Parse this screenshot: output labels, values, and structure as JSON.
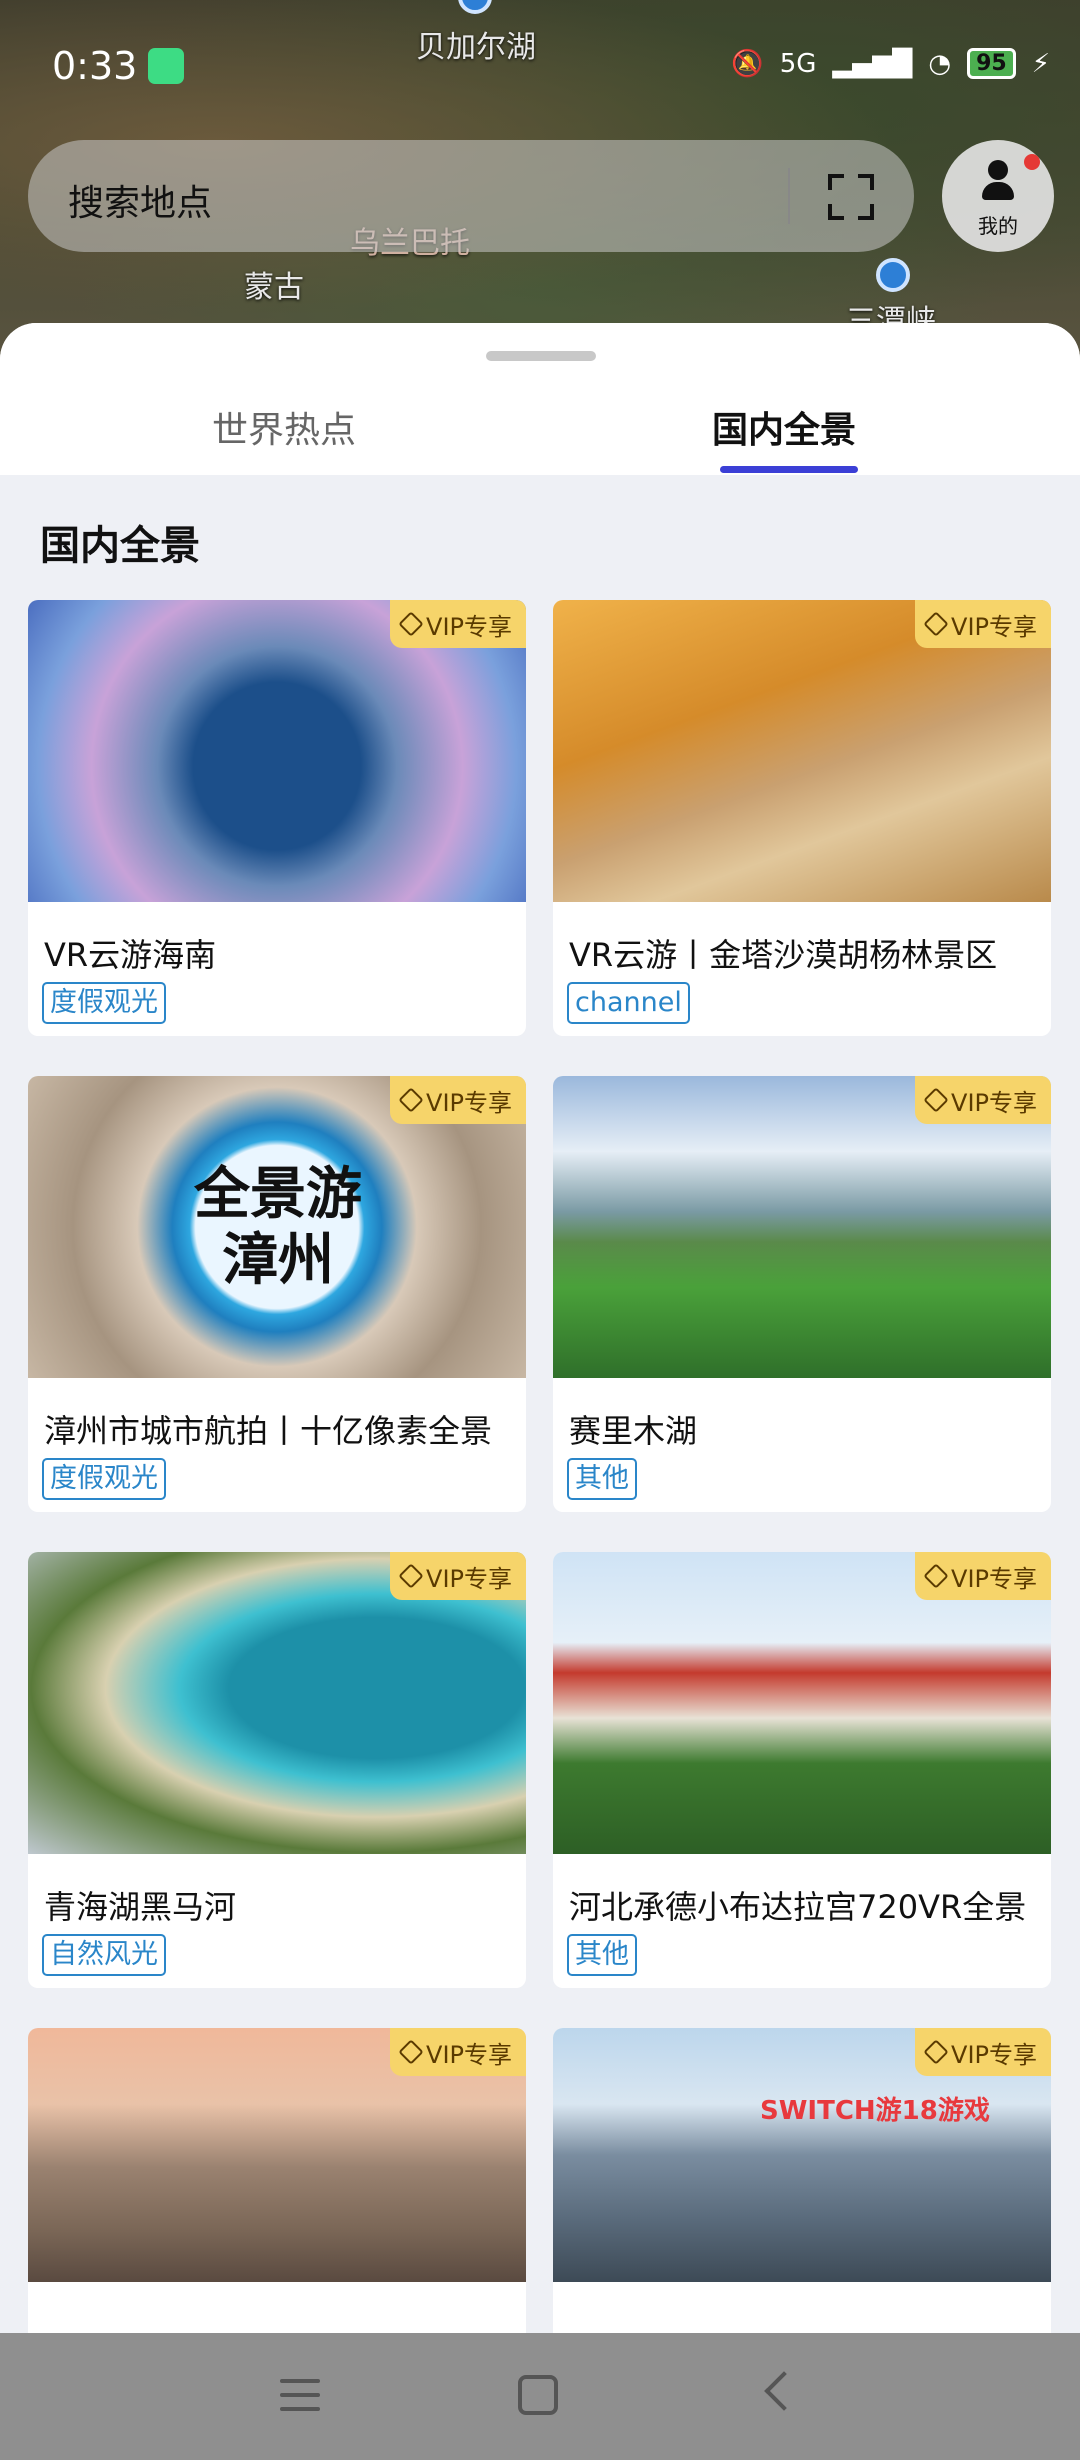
{
  "status_bar": {
    "time": "0:33",
    "network": "5G",
    "battery": "95"
  },
  "map": {
    "labels": [
      "贝加尔湖",
      "乌兰巴托",
      "蒙古",
      "三潭峡"
    ]
  },
  "search": {
    "placeholder": "搜索地点"
  },
  "profile": {
    "label": "我的"
  },
  "tabs": [
    {
      "label": "世界热点",
      "active": false
    },
    {
      "label": "国内全景",
      "active": true
    }
  ],
  "section": {
    "title": "国内全景"
  },
  "vip_label": "VIP专享",
  "cards": [
    {
      "title": "VR云游海南",
      "tag": "度假观光"
    },
    {
      "title": "VR云游丨金塔沙漠胡杨林景区",
      "tag": "channel"
    },
    {
      "title": "漳州市城市航拍丨十亿像素全景",
      "tag": "度假观光",
      "image_text": "全景游漳州"
    },
    {
      "title": "赛里木湖",
      "tag": "其他"
    },
    {
      "title": "青海湖黑马河",
      "tag": "自然风光"
    },
    {
      "title": "河北承德小布达拉宫720VR全景",
      "tag": "其他"
    },
    {
      "title": "",
      "tag": ""
    },
    {
      "title": "",
      "tag": ""
    }
  ],
  "watermark": "SWITCH游18游戏",
  "colors": {
    "accent": "#3b3fd6",
    "tag": "#2a86c9",
    "vip": "#f6d46a"
  }
}
